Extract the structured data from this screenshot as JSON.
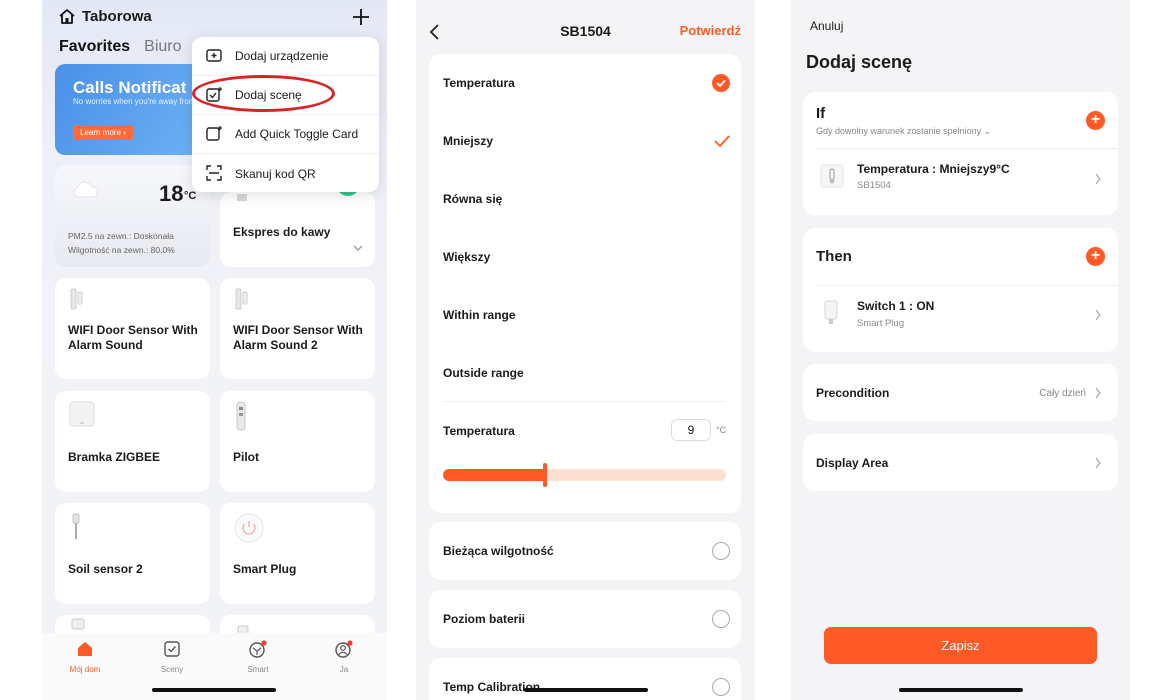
{
  "screen1": {
    "home_title": "Taborowa",
    "tabs": {
      "favorites": "Favorites",
      "biuro": "Biuro"
    },
    "banner": {
      "title": "Calls Notificat",
      "subtitle": "No worries when you're away from home",
      "button": "Learn more"
    },
    "weather": {
      "temp": "18",
      "unit": "°C",
      "pm25": "PM2.5 na zewn.: Doskonała",
      "humidity": "Wilgotność na zewn.: 80.0%"
    },
    "devices": [
      "Ekspres do kawy",
      "WIFI Door Sensor With Alarm Sound",
      "WIFI Door Sensor With Alarm Sound 2",
      "Bramka ZIGBEE",
      "Pilot",
      "Soil sensor 2",
      "Smart Plug"
    ],
    "menu": [
      "Dodaj urządzenie",
      "Dodaj scenę",
      "Add Quick Toggle Card",
      "Skanuj kod QR"
    ],
    "tabbar": [
      "Mój dom",
      "Sceny",
      "Smart",
      "Ja"
    ],
    "accent": "#ff5a26"
  },
  "screen2": {
    "title": "SB1504",
    "confirm": "Potwierdź",
    "options": [
      "Temperatura",
      "Mniejszy",
      "Równa się",
      "Większy",
      "Within range",
      "Outside range"
    ],
    "temp_label": "Temperatura",
    "temp_value": "9",
    "temp_unit": "°C",
    "slider_fraction": 0.36,
    "other": [
      "Bieżąca wilgotność",
      "Poziom baterii",
      "Temp Calibration"
    ]
  },
  "screen3": {
    "cancel": "Anuluj",
    "title": "Dodaj scenę",
    "if_title": "If",
    "if_sub": "Gdy dowolny warunek zostanie spełniony",
    "if_row_title": "Temperatura : Mniejszy9°C",
    "if_row_sub": "SB1504",
    "then_title": "Then",
    "then_row_title": "Switch 1 : ON",
    "then_row_sub": "Smart Plug",
    "precondition": "Precondition",
    "precondition_value": "Cały dzień",
    "display_area": "Display Area",
    "save": "Zapisz"
  }
}
